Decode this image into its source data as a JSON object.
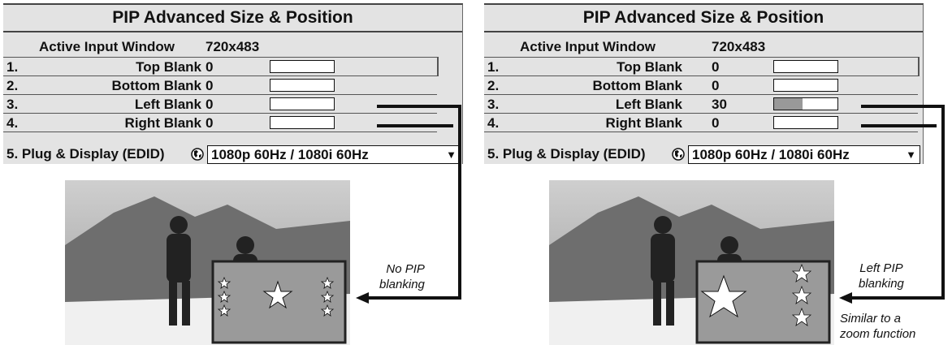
{
  "panels": [
    {
      "title": "PIP Advanced Size & Position",
      "active_input": {
        "label": "Active Input Window",
        "value": "720x483"
      },
      "rows": [
        {
          "num": "1.",
          "label": "Top Blank",
          "value": "0",
          "fill": 0
        },
        {
          "num": "2.",
          "label": "Bottom Blank",
          "value": "0",
          "fill": 0
        },
        {
          "num": "3.",
          "label": "Left Blank",
          "value": "0",
          "fill": 0
        },
        {
          "num": "4.",
          "label": "Right Blank",
          "value": "0",
          "fill": 0
        }
      ],
      "plug": {
        "label": "5. Plug & Display (EDID)",
        "value": "1080p 60Hz / 1080i 60Hz",
        "arrow": "▼"
      },
      "annotation": [
        "No PIP",
        "blanking"
      ]
    },
    {
      "title": "PIP Advanced Size & Position",
      "active_input": {
        "label": "Active Input Window",
        "value": "720x483"
      },
      "rows": [
        {
          "num": "1.",
          "label": "Top Blank",
          "value": "0",
          "fill": 0
        },
        {
          "num": "2.",
          "label": "Bottom Blank",
          "value": "0",
          "fill": 0
        },
        {
          "num": "3.",
          "label": "Left Blank",
          "value": "30",
          "fill": 0.45
        },
        {
          "num": "4.",
          "label": "Right Blank",
          "value": "0",
          "fill": 0
        }
      ],
      "plug": {
        "label": "5. Plug & Display (EDID)",
        "value": "1080p 60Hz / 1080i 60Hz",
        "arrow": "▼"
      },
      "annotation": [
        "Left PIP",
        "blanking"
      ],
      "annotation_extra": [
        "Similar to a",
        "zoom function"
      ]
    }
  ],
  "icons": {
    "globe": "globe-icon",
    "dropdown": "chevron-down-icon",
    "star": "star-icon"
  },
  "colors": {
    "panel_bg": "#e3e3e3",
    "pip_bg": "#9a9a9a",
    "bar_fill": "#999999"
  }
}
